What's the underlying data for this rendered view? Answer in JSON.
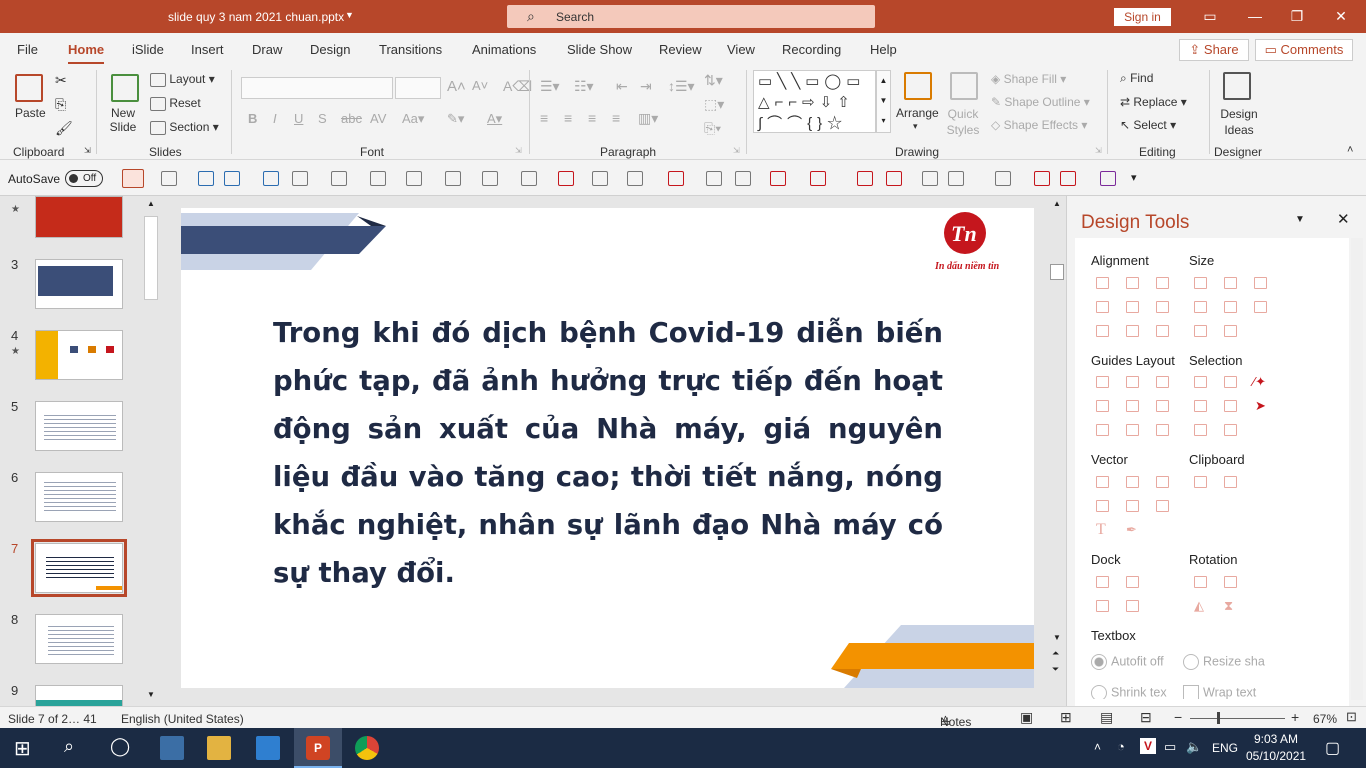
{
  "titlebar": {
    "document_name": "slide quy 3 nam 2021 chuan.pptx",
    "search_placeholder": "Search",
    "signin_label": "Sign in",
    "accent": "#b7472a"
  },
  "tabs": [
    "File",
    "Home",
    "iSlide",
    "Insert",
    "Draw",
    "Design",
    "Transitions",
    "Animations",
    "Slide Show",
    "Review",
    "View",
    "Recording",
    "Help"
  ],
  "active_tab": "Home",
  "share_label": "Share",
  "comments_label": "Comments",
  "ribbon": {
    "clipboard": {
      "paste": "Paste",
      "label": "Clipboard"
    },
    "slides": {
      "new_slide": "New Slide",
      "layout": "Layout",
      "reset": "Reset",
      "section": "Section",
      "label": "Slides"
    },
    "font": {
      "label": "Font"
    },
    "paragraph": {
      "label": "Paragraph"
    },
    "drawing": {
      "arrange": "Arrange",
      "quick_styles": "Quick Styles",
      "shape_fill": "Shape Fill",
      "shape_outline": "Shape Outline",
      "shape_effects": "Shape Effects",
      "label": "Drawing"
    },
    "editing": {
      "find": "Find",
      "replace": "Replace",
      "select": "Select",
      "label": "Editing"
    },
    "designer": {
      "design_ideas": "Design Ideas",
      "label": "Designer"
    }
  },
  "qat": {
    "autosave": "AutoSave",
    "autosave_state": "Off"
  },
  "thumbnails": [
    {
      "num": "",
      "star": true
    },
    {
      "num": "3",
      "star": false
    },
    {
      "num": "4",
      "star": true
    },
    {
      "num": "5",
      "star": false
    },
    {
      "num": "6",
      "star": false
    },
    {
      "num": "7",
      "star": false
    },
    {
      "num": "8",
      "star": false
    },
    {
      "num": "9",
      "star": false
    }
  ],
  "slide": {
    "body_text": "Trong khi đó dịch bệnh Covid-19 diễn biến phức tạp, đã ảnh hưởng trực tiếp đến hoạt động sản xuất của Nhà máy, giá nguyên liệu đầu vào tăng cao; thời tiết nắng, nóng khắc nghiệt, nhân sự lãnh đạo Nhà máy có sự thay đổi.",
    "logo_tagline": "In dấu niềm tin",
    "colors": {
      "navy": "#3b4e78",
      "light_blue": "#c9d3e6",
      "orange": "#f39200",
      "red": "#c5161d"
    }
  },
  "design_tools": {
    "title": "Design Tools",
    "sections": {
      "alignment": "Alignment",
      "size": "Size",
      "guides_layout": "Guides Layout",
      "selection": "Selection",
      "vector": "Vector",
      "clipboard": "Clipboard",
      "dock": "Dock",
      "rotation": "Rotation",
      "textbox": "Textbox"
    },
    "textbox_options": {
      "autofit": "Autofit off",
      "resize": "Resize sha",
      "shrink": "Shrink tex",
      "wrap": "Wrap text"
    }
  },
  "status": {
    "slide_info": "Slide 7 of 2… 41",
    "language": "English (United States)",
    "notes": "Notes",
    "zoom": "67%"
  },
  "taskbar": {
    "lang": "ENG",
    "time": "9:03 AM",
    "date": "05/10/2021"
  }
}
